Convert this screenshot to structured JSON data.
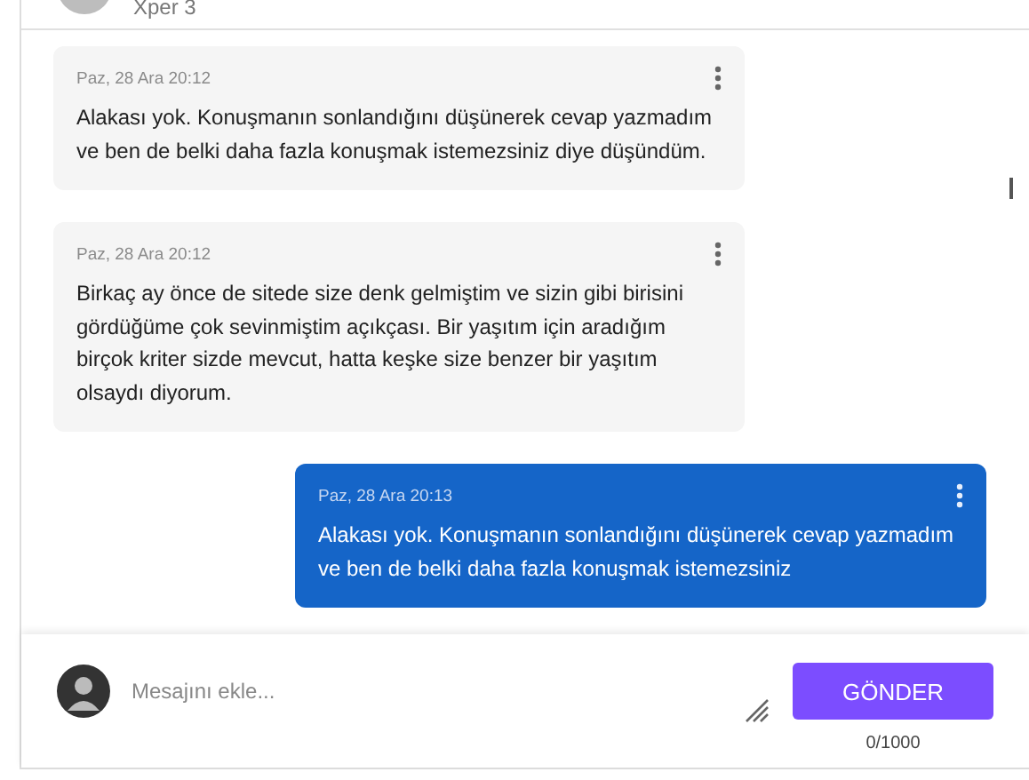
{
  "header": {
    "name": "Xper 3"
  },
  "messages": [
    {
      "kind": "received",
      "time": "Paz, 28 Ara 20:12",
      "text": "Alakası yok. Konuşmanın sonlandığını düşünerek cevap yazmadım ve ben de belki daha fazla konuşmak istemezsiniz diye düşündüm."
    },
    {
      "kind": "received",
      "time": "Paz, 28 Ara 20:12",
      "text": "Birkaç ay önce de sitede size denk gelmiştim ve sizin gibi birisini gördüğüme çok sevinmiştim açıkçası. Bir yaşıtım için aradığım birçok kriter sizde mevcut, hatta keşke size benzer bir yaşıtım olsaydı diyorum."
    },
    {
      "kind": "sent",
      "time": "Paz, 28 Ara 20:13",
      "text": "Alakası yok. Konuşmanın sonlandığını düşünerek cevap yazmadım ve ben de belki daha fazla konuşmak istemezsiniz"
    }
  ],
  "composer": {
    "placeholder": "Mesajını ekle...",
    "send_button": "GÖNDER",
    "counter": "0/1000"
  }
}
